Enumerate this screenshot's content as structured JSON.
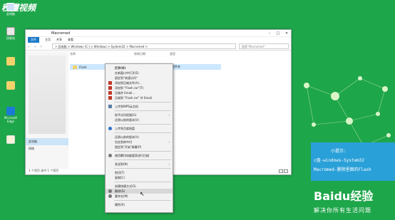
{
  "watermark": "秒懂视频",
  "desktop_icons": [
    {
      "label": "此电脑",
      "icon": "pc-icon"
    },
    {
      "label": "回收站",
      "icon": "disk-icon"
    },
    {
      "label": "",
      "icon": "folder-icon"
    },
    {
      "label": "",
      "icon": "folder-icon"
    },
    {
      "label": "Microsoft Edge",
      "icon": "edge-icon"
    },
    {
      "label": "",
      "icon": "document-icon"
    }
  ],
  "window": {
    "title": "Macromed",
    "ribbon": [
      "文件",
      "主页",
      "共享",
      "查看"
    ],
    "path": "> 此电脑 > Windows (C:) > Windows > System32 > Macromed >",
    "search_placeholder": "搜索\"Macromed\"",
    "columns": [
      "名称",
      "修改日期",
      "类型"
    ],
    "file": {
      "name": "Flash",
      "type": "文件夹"
    },
    "sidebar": {
      "this_pc": "此电脑",
      "network": "网络"
    },
    "status": "1 个项目  选中 1 个项目"
  },
  "context_menu": [
    {
      "label": "打开(O)",
      "bold": true
    },
    {
      "label": "在新窗口中打开(E)"
    },
    {
      "label": "固定到\"快速访问\""
    },
    {
      "label": "添加到压缩文件(A)...",
      "icon": "archive-icon"
    },
    {
      "label": "添加到 \"Flash.rar\"(T)",
      "icon": "archive-icon"
    },
    {
      "label": "压缩并 Email...",
      "icon": "archive-icon"
    },
    {
      "label": "压缩到 \"Flash.rar\" 并 Email",
      "icon": "archive-icon"
    },
    {
      "sep": true
    },
    {
      "label": "上传到WPS云文档",
      "icon": "cloud-icon"
    },
    {
      "sep": true
    },
    {
      "label": "授予访问权限(G)",
      "arrow": true
    },
    {
      "label": "还原以前的版本(V)"
    },
    {
      "sep": true
    },
    {
      "label": "上传到百度网盘",
      "icon": "baidu-icon"
    },
    {
      "sep": true
    },
    {
      "label": "还原以前的版本(V)"
    },
    {
      "label": "包含到库中(I)",
      "arrow": true
    },
    {
      "label": "固定到\"开始\"屏幕(P)"
    },
    {
      "sep": true
    },
    {
      "label": "使用腾讯电脑管家进行扫描",
      "icon": "shield-icon"
    },
    {
      "sep": true
    },
    {
      "label": "发送到(N)",
      "arrow": true
    },
    {
      "sep": true
    },
    {
      "label": "剪切(T)"
    },
    {
      "label": "复制(C)"
    },
    {
      "sep": true
    },
    {
      "label": "创建快捷方式(S)"
    },
    {
      "label": "删除(D)",
      "highlight": true,
      "icon": "shield-icon"
    },
    {
      "label": "重命名(M)",
      "icon": "shield-icon"
    },
    {
      "sep": true
    },
    {
      "label": "属性(R)"
    }
  ],
  "tip": {
    "heading": "小提示:",
    "line1": "c盘-windows-System32",
    "line2": "Macromed-删除里面的Flash"
  },
  "brand": {
    "logo": "Baidu经验",
    "slogan": "解决你所有生活问题"
  },
  "colors": {
    "desktop": "#1ea64a",
    "tip": "#2aa0d8",
    "file_tab": "#1979ca"
  }
}
